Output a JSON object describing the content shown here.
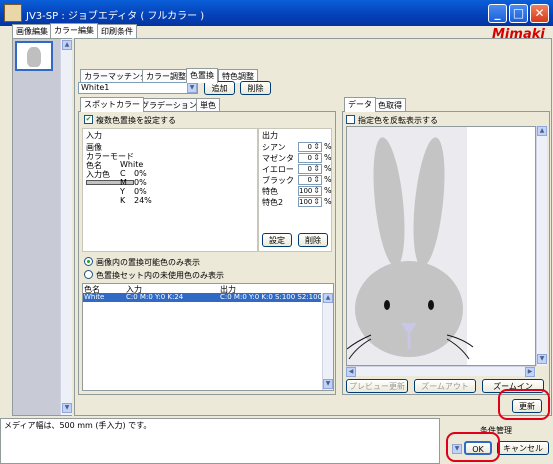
{
  "window": {
    "title": "JV3-SP : ジョブエディタ ( フルカラー )",
    "brand": "Mimaki"
  },
  "main_tabs": [
    "画像編集",
    "カラー編集",
    "印刷条件"
  ],
  "sub_tabs": [
    "カラーマッチング",
    "カラー調整",
    "色置換",
    "特色調整"
  ],
  "color_select": {
    "value": "White1",
    "add": "追加",
    "delete": "削除"
  },
  "left_tabs": [
    "スポットカラー",
    "グラデーション",
    "単色"
  ],
  "multi_replace": "複数色置換を設定する",
  "input": {
    "header": "入力",
    "image_label": "画像",
    "color_mode_label": "カラーモード",
    "color_name_label": "色名",
    "color_name_value": "White",
    "input_color_label": "入力色",
    "cmyk": [
      [
        "C",
        "0%"
      ],
      [
        "M",
        "0%"
      ],
      [
        "Y",
        "0%"
      ],
      [
        "K",
        "24%"
      ]
    ]
  },
  "output": {
    "header": "出力",
    "rows": [
      {
        "label": "シアン",
        "value": "0"
      },
      {
        "label": "マゼンタ",
        "value": "0"
      },
      {
        "label": "イエロー",
        "value": "0"
      },
      {
        "label": "ブラック",
        "value": "0"
      },
      {
        "label": "特色",
        "value": "100"
      },
      {
        "label": "特色2",
        "value": "100"
      }
    ],
    "unit": "%",
    "set_button": "設定",
    "delete_button": "削除"
  },
  "radios": {
    "option1": "画像内の置換可能色のみ表示",
    "option2": "色置換セット内の未使用色のみ表示"
  },
  "table": {
    "headers": [
      "色名",
      "入力",
      "出力"
    ],
    "rows": [
      {
        "name": "White",
        "input": "C:0 M:0 Y:0 K:24",
        "output": "C:0 M:0 Y:0 K:0 S:100 S2:100"
      }
    ]
  },
  "right_tabs": [
    "データ",
    "色取得"
  ],
  "invert_check": "指定色を反転表示する",
  "preview_buttons": {
    "update": "プレビュー更新",
    "zoom_out": "ズームアウト",
    "zoom_in": "ズームイン"
  },
  "refresh_button": "更新",
  "status": {
    "message": "メディア幅は、500 mm (手入力) です。",
    "condition_label": "条件管理"
  },
  "footer": {
    "ok": "OK",
    "cancel": "キャンセル"
  },
  "colors": {
    "titlebar": "#0440b8",
    "highlight": "#e0001a",
    "selection": "#316ac5",
    "accent_red": "#d60000"
  }
}
